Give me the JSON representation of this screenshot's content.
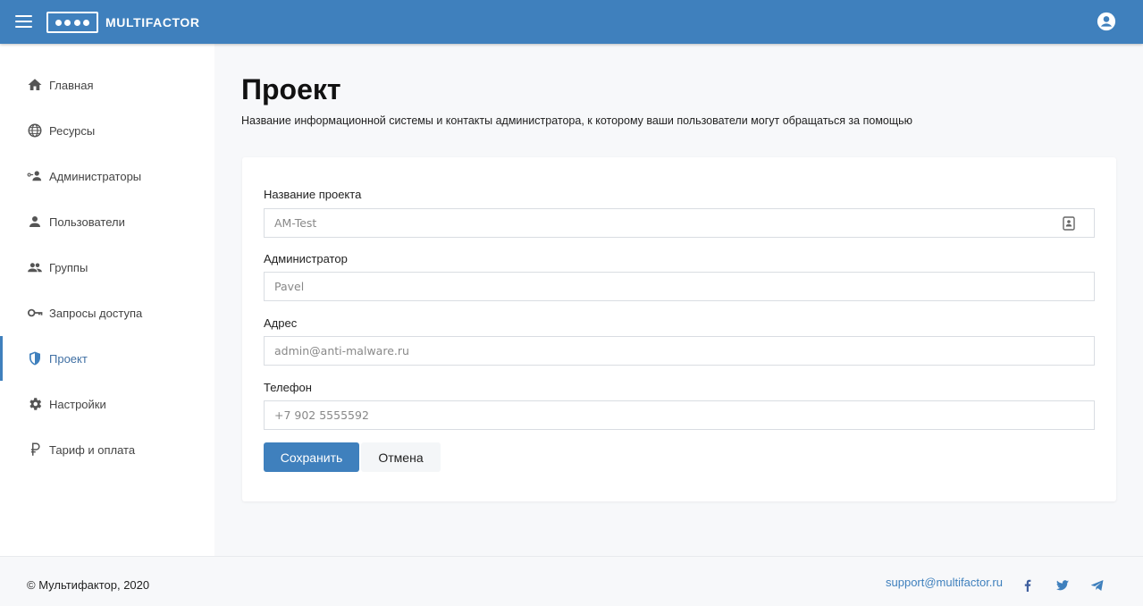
{
  "header": {
    "brand": "MULTIFACTOR",
    "icons": {
      "menu": "hamburger-menu-icon",
      "user": "account-circle-icon"
    }
  },
  "sidebar": {
    "items": [
      {
        "label": "Главная",
        "icon": "home-icon",
        "active": false
      },
      {
        "label": "Ресурсы",
        "icon": "globe-icon",
        "active": false
      },
      {
        "label": "Администраторы",
        "icon": "admin-key-icon",
        "active": false
      },
      {
        "label": "Пользователи",
        "icon": "person-icon",
        "active": false
      },
      {
        "label": "Группы",
        "icon": "people-icon",
        "active": false
      },
      {
        "label": "Запросы доступа",
        "icon": "key-icon",
        "active": false
      },
      {
        "label": "Проект",
        "icon": "shield-icon",
        "active": true
      },
      {
        "label": "Настройки",
        "icon": "gear-icon",
        "active": false
      },
      {
        "label": "Тариф и оплата",
        "icon": "ruble-icon",
        "active": false
      }
    ]
  },
  "main": {
    "title": "Проект",
    "description": "Название информационной системы и контакты администратора, к которому ваши пользователи могут обращаться за помощью",
    "form": {
      "fields": [
        {
          "label": "Название проекта",
          "value": "AM-Test"
        },
        {
          "label": "Администратор",
          "value": "Pavel"
        },
        {
          "label": "Адрес",
          "value": "admin@anti-malware.ru"
        },
        {
          "label": "Телефон",
          "value": "+7 902 5555592"
        }
      ],
      "save_label": "Сохранить",
      "cancel_label": "Отмена"
    }
  },
  "footer": {
    "copyright": "© Мультифактор, 2020",
    "support_email": "support@multifactor.ru",
    "social": [
      "facebook-icon",
      "twitter-icon",
      "telegram-icon"
    ]
  },
  "colors": {
    "accent": "#3f80bd",
    "background": "#f7f8fa",
    "card": "#ffffff"
  }
}
